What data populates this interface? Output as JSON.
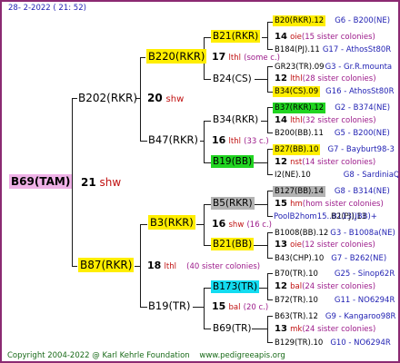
{
  "header": {
    "date": "28-  2-2022 ( 21: 52)"
  },
  "footer": {
    "copyright": "Copyright 2004-2022 @ Karl Kehrle Foundation",
    "site": "www.pedigreeapis.org"
  },
  "root": {
    "name": "B69(TAM)",
    "num": "21",
    "tag": "shw"
  },
  "g1": [
    {
      "name": "B202(RKR)",
      "num": "20",
      "tag": "shw"
    },
    {
      "name": "B87(RKR)",
      "num": "18",
      "tag": "lthl",
      "note": "(40 sister colonies)"
    }
  ],
  "g2": [
    {
      "name": "B220(RKR)",
      "num": "17",
      "tag": "lthl",
      "note": "(some c.)"
    },
    {
      "name": "B47(RKR)",
      "num": "16",
      "tag": "lthl",
      "note": "(33 c.)"
    },
    {
      "name": "B3(RKR)",
      "num": "16",
      "tag": "shw",
      "note": "(16 c.)"
    },
    {
      "name": "B19(TR)",
      "num": "15",
      "tag": "bal",
      "note": "(20 c.)"
    }
  ],
  "g3": [
    {
      "name": "B21(RKR)"
    },
    {
      "name": "B24(CS)"
    },
    {
      "name": "B34(RKR)"
    },
    {
      "name": "B19(BB)"
    },
    {
      "name": "B5(RKR)"
    },
    {
      "name": "B21(BB)"
    },
    {
      "name": "B173(TR)"
    },
    {
      "name": "B69(TR)"
    }
  ],
  "g4": [
    {
      "top": "B20(RKR).12",
      "topCode": "G6 - B200(NE)",
      "num": "14",
      "tag": "oie",
      "note": "(15 sister colonies)",
      "bot": "B184(PJ).11",
      "botCode": "G17 - AthosSt80R"
    },
    {
      "top": "GR23(TR).09",
      "topCode": "G3 - Gr.R.mounta",
      "num": "12",
      "tag": "lthl",
      "note": "(28 sister colonies)",
      "bot": "B34(CS).09",
      "botCode": "G16 - AthosSt80R"
    },
    {
      "top": "B37(RKR).12",
      "topCode": "G2 - B374(NE)",
      "num": "14",
      "tag": "lthl",
      "note": "(32 sister colonies)",
      "bot": "B200(BB).11",
      "botCode": "G5 - B200(NE)"
    },
    {
      "top": "B27(BB).10",
      "topCode": "G7 - Bayburt98-3",
      "num": "12",
      "tag": "nst",
      "note": "(14 sister colonies)",
      "bot": "I2(NE).10",
      "botCode": "G8 - SardiniaQ"
    },
    {
      "top": "B127(BB).14",
      "topCode": "G8 - B314(NE)",
      "num": "15",
      "tag": "hm",
      "note": "(hom sister colonies)",
      "bot": "PoolB2hom15..B113(JBB)+",
      "botCode": "B2(PJ).13"
    },
    {
      "top": "B1008(BB).12",
      "topCode": "G3 - B1008a(NE)",
      "num": "13",
      "tag": "oie",
      "note": "(12 sister colonies)",
      "bot": "B43(CHP).10",
      "botCode": "G7 - B262(NE)"
    },
    {
      "top": "B70(TR).10",
      "topCode": "G25 - Sinop62R",
      "num": "12",
      "tag": "bal",
      "note": "(24 sister colonies)",
      "bot": "B72(TR).10",
      "botCode": "G11 - NO6294R"
    },
    {
      "top": "B63(TR).12",
      "topCode": "G9 - Kangaroo98R",
      "num": "13",
      "tag": "mk",
      "note": "(24 sister colonies)",
      "bot": "B129(TR).10",
      "botCode": "G10 - NO6294R"
    }
  ]
}
